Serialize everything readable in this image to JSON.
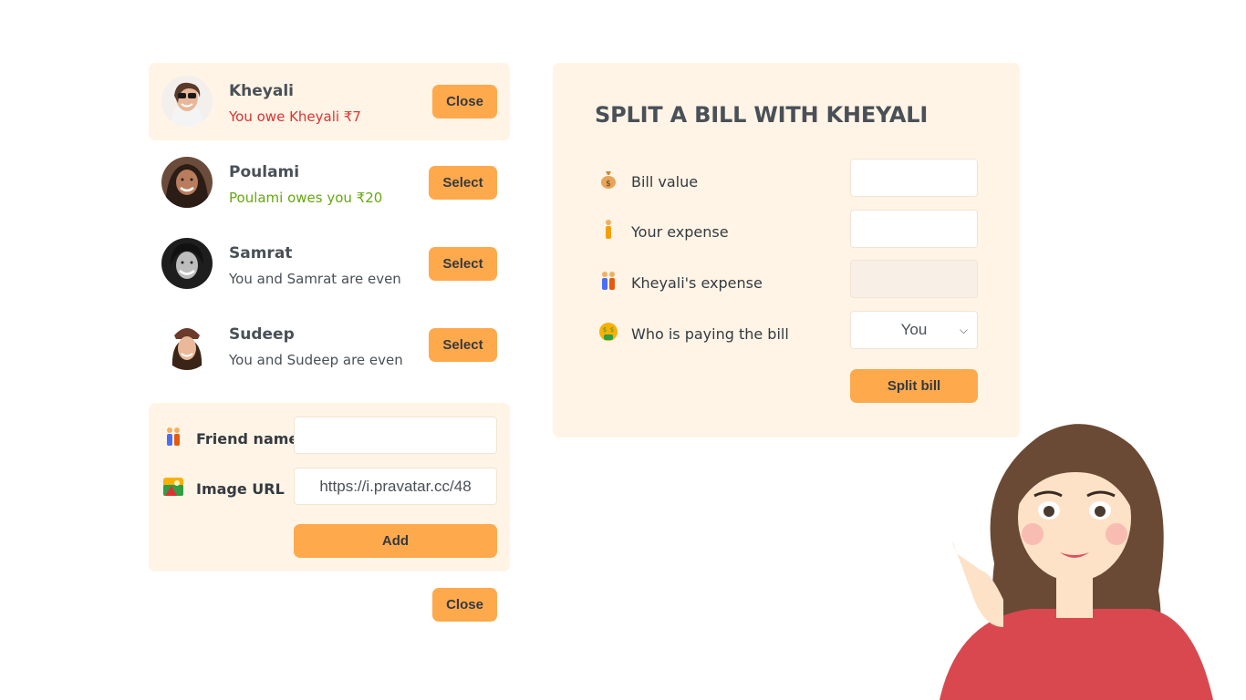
{
  "friends": [
    {
      "name": "Kheyali",
      "status": "You owe Kheyali ₹7",
      "button": "Close"
    },
    {
      "name": "Poulami",
      "status": "Poulami owes you ₹20",
      "button": "Select"
    },
    {
      "name": "Samrat",
      "status": "You and Samrat are even",
      "button": "Select"
    },
    {
      "name": "Sudeep",
      "status": "You and Sudeep are even",
      "button": "Select"
    }
  ],
  "add_form": {
    "name_label": "Friend name",
    "name_value": "",
    "image_label": "Image URL",
    "image_value": "https://i.pravatar.cc/48",
    "add_button": "Add"
  },
  "close_button": "Close",
  "split_form": {
    "title": "SPLIT A BILL WITH KHEYALI",
    "bill_label": "Bill value",
    "expense_label": "Your expense",
    "friend_expense_label": "Kheyali's expense",
    "payer_label": "Who is paying the bill",
    "payer_value": "You",
    "submit": "Split bill"
  },
  "colors": {
    "accent": "#ffa94d",
    "panel": "#fff4e6",
    "owe": "#e03131",
    "owed": "#66a80f"
  },
  "icons": [
    "money-bag-icon",
    "person-icon",
    "people-icon",
    "money-face-icon",
    "landscape-icon"
  ]
}
